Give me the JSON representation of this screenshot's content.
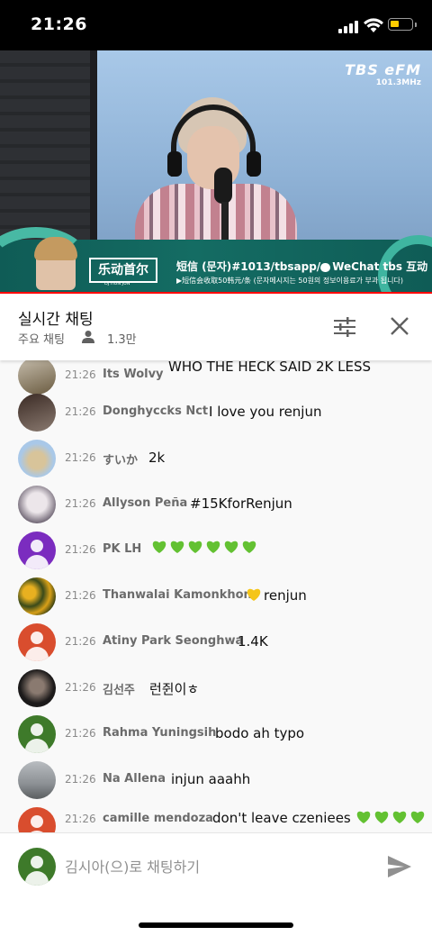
{
  "status_bar": {
    "time": "21:26",
    "battery_color": "#ffcc00"
  },
  "video": {
    "station_logo": "TBS eFM",
    "frequency": "101.3MHz",
    "dj_logo": "乐动首尔",
    "dj_logo_sub": "DJ HUN JUN",
    "banner_line1": "短信 (문자)#1013/tbsapp/",
    "banner_wechat": "WeChat",
    "banner_line1_end": "tbs 互动",
    "banner_line2": "▶短信会收取50韩元/条 (문자메시지는 50원의 정보이용료가 부과 됩니다)",
    "progress": 1.0
  },
  "chat_header": {
    "title": "실시간 채팅",
    "mode": "주요 채팅",
    "viewer_count": "1.3만"
  },
  "messages": [
    {
      "time": "21:26",
      "author": "Its Wolvy",
      "text": "WHO THE HECK SAID 2K LESS"
    },
    {
      "time": "21:26",
      "author": "Donghyccks Nct",
      "text": "I love you renjun"
    },
    {
      "time": "21:26",
      "author": "すいか",
      "text": "2k"
    },
    {
      "time": "21:26",
      "author": "Allyson Peña",
      "text": "#15KforRenjun"
    },
    {
      "time": "21:26",
      "author": "PK LH",
      "text": "",
      "hearts": 6
    },
    {
      "time": "21:26",
      "author": "Thanwalai Kamonkhon",
      "text": "renjun",
      "hearts_before": 1
    },
    {
      "time": "21:26",
      "author": "Atiny Park Seonghwa",
      "text": "1.4K"
    },
    {
      "time": "21:26",
      "author": "김선주",
      "text": "런쥔이ㅎ"
    },
    {
      "time": "21:26",
      "author": "Rahma Yuningsih",
      "text": "bodo ah typo"
    },
    {
      "time": "21:26",
      "author": "Na Allena",
      "text": "injun aaahh"
    },
    {
      "time": "21:26",
      "author": "camille mendoza",
      "text": "don't leave czeniees",
      "hearts": 4
    }
  ],
  "input": {
    "placeholder": "김시아(으)로 채팅하기"
  },
  "colors": {
    "heart_green": "#63c132",
    "heart_yellow": "#f5c518",
    "accent_red": "#ff0000"
  }
}
